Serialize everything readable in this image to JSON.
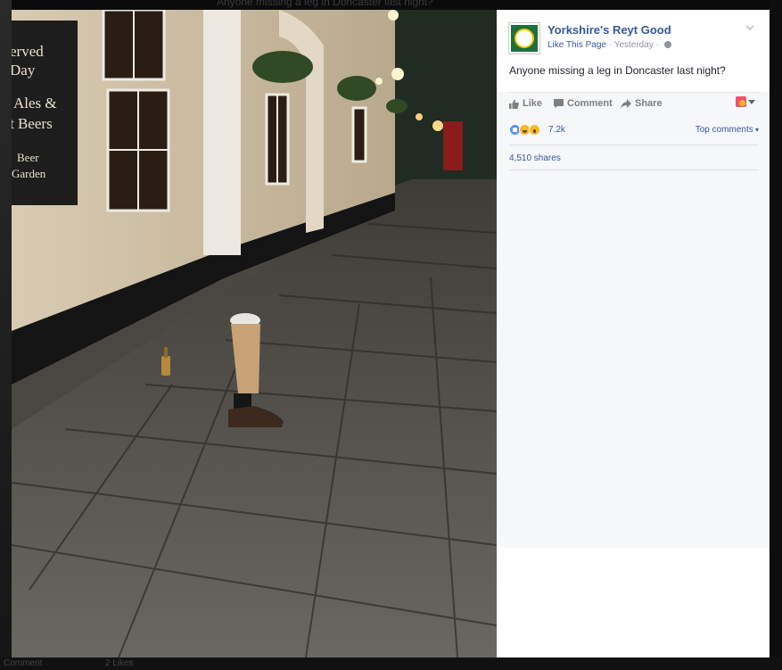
{
  "background": {
    "caption": "Anyone missing a leg in Doncaster last night?",
    "bottom_left": "Comment",
    "bottom_likes": "2 Likes"
  },
  "photo": {
    "sign_lines": [
      "erved",
      "Day",
      "Ales &",
      "t Beers",
      "Beer",
      "Garden"
    ]
  },
  "post": {
    "page_name": "Yorkshire's Reyt Good",
    "like_link": "Like This Page",
    "sep1": " · ",
    "timestamp": "Yesterday",
    "sep2": " · ",
    "text": "Anyone missing a leg in Doncaster last night?"
  },
  "actions": {
    "like": "Like",
    "comment": "Comment",
    "share": "Share"
  },
  "reactions": {
    "count": "7.2k",
    "types": [
      "like-icon",
      "haha-icon",
      "wow-icon"
    ],
    "top_comments": "Top comments"
  },
  "shares": "4,510 shares",
  "colors": {
    "link": "#365899",
    "panel_bg": "#f6f7f9",
    "like_blue": "#5890ff"
  }
}
